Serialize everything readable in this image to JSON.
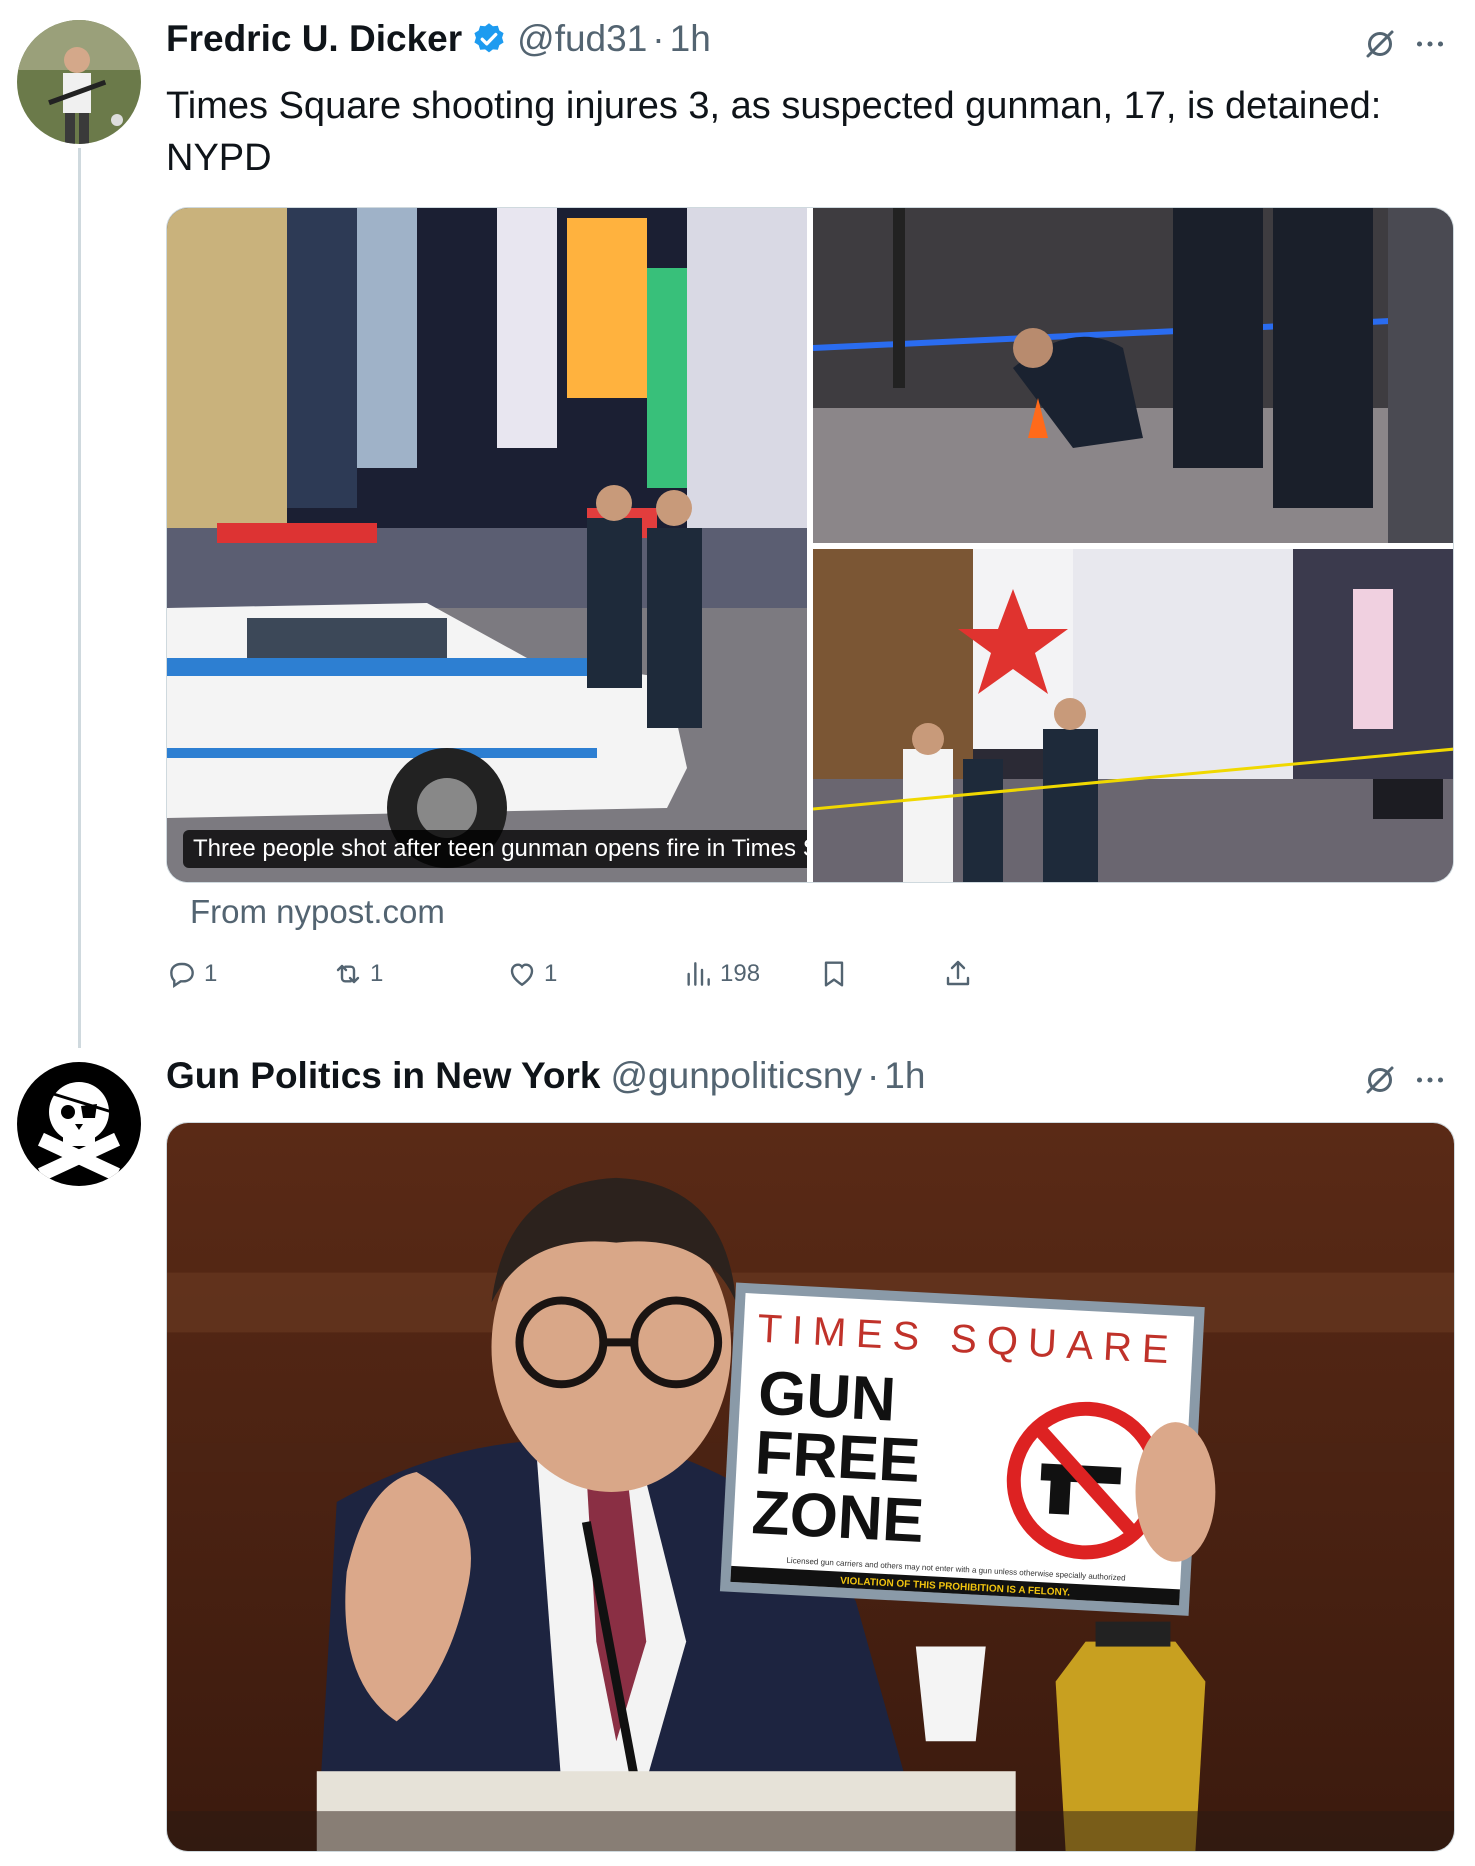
{
  "tweets": [
    {
      "display_name": "Fredric U. Dicker",
      "handle": "@fud31",
      "dot": "·",
      "time": "1h",
      "text": "Times Square shooting injures 3, as suspected gunman, 17, is detained: NYPD",
      "card": {
        "caption": "Three people shot after teen gunman opens fire in Times Square,...",
        "source": "From nypost.com"
      },
      "actions": {
        "replies": "1",
        "reposts": "1",
        "likes": "1",
        "views": "198"
      },
      "icons": [
        "verified-badge-icon",
        "grok-icon",
        "more-icon",
        "reply-icon",
        "repost-icon",
        "like-icon",
        "views-icon",
        "bookmark-icon",
        "share-icon"
      ]
    },
    {
      "display_name": "Gun Politics in New York",
      "handle": "@gunpoliticsny",
      "dot": "·",
      "time": "1h",
      "photo_sign": {
        "line1": "TIMES SQUARE",
        "line2": "GUN",
        "line3": "FREE",
        "line4": "ZONE",
        "fine_print": "Licensed gun carriers and others may not enter with a gun unless otherwise specially authorized",
        "warning": "VIOLATION OF THIS PROHIBITION IS A FELONY."
      }
    }
  ],
  "colors": {
    "verified_blue": "#1d9bf0",
    "secondary_text": "#536471",
    "thread_line": "#cfd9de"
  }
}
